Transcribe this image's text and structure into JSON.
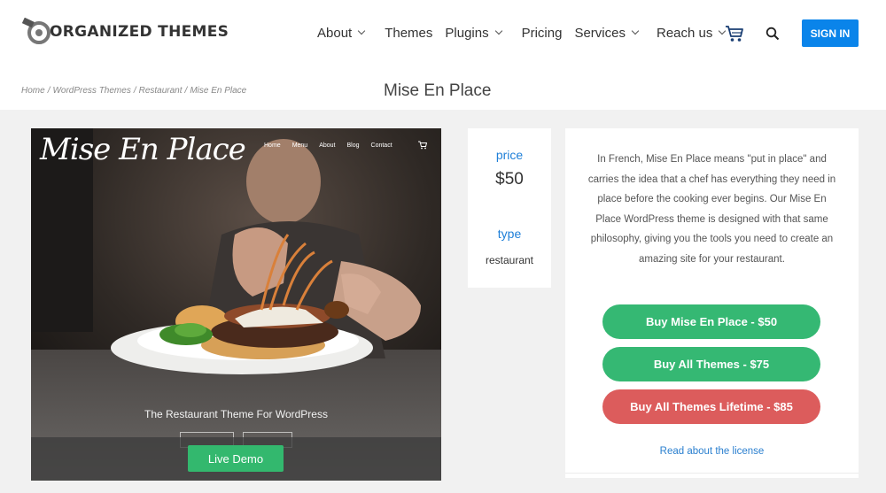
{
  "header": {
    "logo_text": "ORGANIZED THEMES",
    "nav": [
      {
        "label": "About",
        "dropdown": true
      },
      {
        "label": "Themes",
        "dropdown": false
      },
      {
        "label": "Plugins",
        "dropdown": true
      },
      {
        "label": "Pricing",
        "dropdown": false
      },
      {
        "label": "Services",
        "dropdown": true
      },
      {
        "label": "Reach us",
        "dropdown": true
      }
    ],
    "signin_label": "SIGN IN",
    "accent_color": "#0a84ea"
  },
  "breadcrumb": {
    "items": [
      "Home",
      "WordPress Themes",
      "Restaurant",
      "Mise En Place"
    ]
  },
  "page_title": "Mise En Place",
  "preview": {
    "logo": "Mise En Place",
    "nav": [
      "Home",
      "Menu",
      "About",
      "Blog",
      "Contact"
    ],
    "tagline": "The Restaurant Theme For WordPress",
    "live_demo_label": "Live Demo"
  },
  "product": {
    "price_label": "price",
    "price_value": "$50",
    "type_label": "type",
    "type_value": "restaurant"
  },
  "description": {
    "text": "In French, Mise En Place means \"put in place\" and carries the idea that a chef has everything they need in place before the cooking ever begins. Our Mise En Place WordPress theme is designed with that same philosophy, giving you the tools you need to create an amazing site for your restaurant.",
    "buy_theme_label": "Buy Mise En Place - $50",
    "buy_all_label": "Buy All Themes - $75",
    "buy_lifetime_label": "Buy All Themes Lifetime - $85",
    "license_label": "Read about the license",
    "green_color": "#35b873",
    "red_color": "#dc5c5c"
  }
}
